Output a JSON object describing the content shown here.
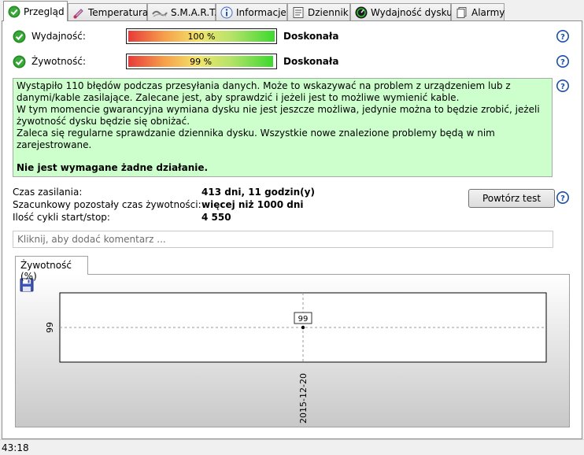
{
  "tabs": [
    {
      "label": "Przegląd",
      "icon": "check-circle-icon",
      "active": true
    },
    {
      "label": "Temperatura",
      "icon": "thermometer-icon",
      "active": false
    },
    {
      "label": "S.M.A.R.T.",
      "icon": "smart-icon",
      "active": false
    },
    {
      "label": "Informacje",
      "icon": "info-icon",
      "active": false
    },
    {
      "label": "Dziennik",
      "icon": "log-icon",
      "active": false
    },
    {
      "label": "Wydajność dysku",
      "icon": "gauge-icon",
      "active": false
    },
    {
      "label": "Alarmy",
      "icon": "alarm-icon",
      "active": false
    }
  ],
  "performance": {
    "label": "Wydajność:",
    "value_text": "100 %",
    "percent": 100,
    "rating": "Doskonała",
    "status_icon": "check-circle-icon"
  },
  "health": {
    "label": "Żywotność:",
    "value_text": "99 %",
    "percent": 99,
    "rating": "Doskonała",
    "status_icon": "check-circle-icon"
  },
  "message": {
    "line1": "Wystąpiło 110 błędów podczas przesyłania danych. Może to wskazywać na problem z urządzeniem lub z danymi/kable zasilające. Zalecane jest, aby sprawdzić i jeżeli jest to możliwe wymienić kable.",
    "line2": "W tym momencie gwarancyjna wymiana dysku nie jest jeszcze możliwa, jedynie można to będzie zrobić, jeżeli żywotność dysku będzie się obniżać.",
    "line3": "Zaleca się regularne sprawdzanie dziennika dysku. Wszystkie nowe znalezione problemy będą w nim zarejestrowane.",
    "conclusion": "Nie jest wymagane żadne działanie.",
    "background": "#ccffcc"
  },
  "stats": {
    "power_on_label": "Czas zasilania:",
    "power_on_value": "413 dni, 11 godzin(y)",
    "lifetime_label": "Szacunkowy pozostały czas żywotności:",
    "lifetime_value": "więcej niż 1000 dni",
    "cycles_label": "Ilość cykli start/stop:",
    "cycles_value": "4 550"
  },
  "retest_button": "Powtórz test",
  "comment_placeholder": "Kliknij, aby dodać komentarz ...",
  "chart_tab": "Żywotność (%)",
  "chart_data": {
    "type": "scatter",
    "title": "",
    "xlabel": "",
    "ylabel": "",
    "x": [
      "2015-12-20"
    ],
    "series": [
      {
        "values": [
          99
        ]
      }
    ],
    "data_labels": [
      "99"
    ],
    "x_tick_labels": [
      "2015-12-20"
    ],
    "y_tick_labels": [
      "99"
    ],
    "grid": "dashed crosshair"
  },
  "statusbar": {
    "text": "43:18"
  },
  "colors": {
    "ok_green": "#2e9b2e",
    "help_blue": "#1c4fa8"
  }
}
